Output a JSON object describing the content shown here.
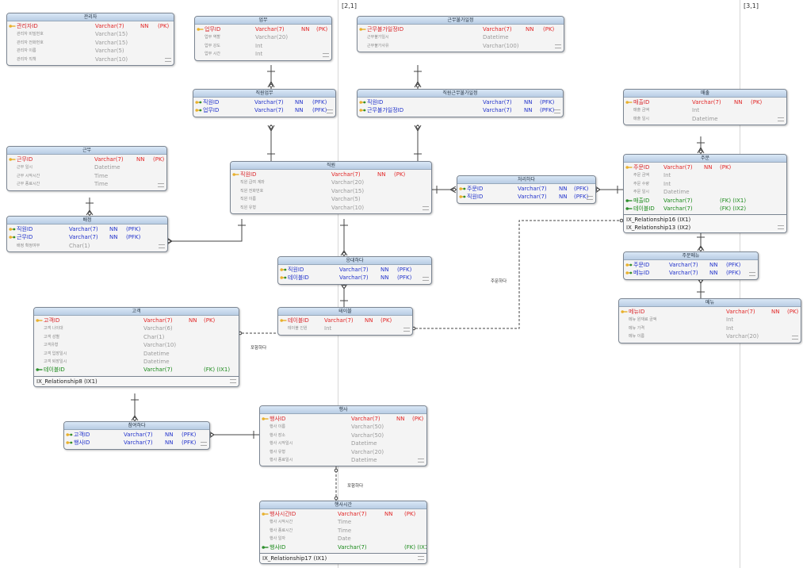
{
  "page_markers": [
    "[2,1]",
    "[3,1]"
  ],
  "entities": [
    {
      "id": "manager",
      "title": "관리자",
      "rows": [
        {
          "kind": "pk",
          "name": "관리자ID",
          "type": "Varchar(7)",
          "nn": "NN",
          "key": "(PK)"
        },
        {
          "kind": "at",
          "name": "관리자 비밀번호",
          "type": "Varchar(15)",
          "nn": "",
          "key": ""
        },
        {
          "kind": "at",
          "name": "관리자 전화번호",
          "type": "Varchar(15)",
          "nn": "",
          "key": ""
        },
        {
          "kind": "at",
          "name": "관리자 이름",
          "type": "Varchar(5)",
          "nn": "",
          "key": ""
        },
        {
          "kind": "at",
          "name": "관리자 직책",
          "type": "Varchar(10)",
          "nn": "",
          "key": ""
        }
      ],
      "indexes": []
    },
    {
      "id": "task",
      "title": "업무",
      "rows": [
        {
          "kind": "pk",
          "name": "업무ID",
          "type": "Varchar(7)",
          "nn": "NN",
          "key": "(PK)"
        },
        {
          "kind": "at",
          "name": "업무 역할",
          "type": "Varchar(20)",
          "nn": "",
          "key": ""
        },
        {
          "kind": "at",
          "name": "업무 강도",
          "type": "Int",
          "nn": "",
          "key": ""
        },
        {
          "kind": "at",
          "name": "업무 시간",
          "type": "Int",
          "nn": "",
          "key": ""
        }
      ],
      "indexes": []
    },
    {
      "id": "unavailable_date",
      "title": "근무불가일정",
      "rows": [
        {
          "kind": "pk",
          "name": "근무불가일정ID",
          "type": "Varchar(7)",
          "nn": "NN",
          "key": "(PK)"
        },
        {
          "kind": "at",
          "name": "근무불가일시",
          "type": "Datetime",
          "nn": "",
          "key": ""
        },
        {
          "kind": "at",
          "name": "근무불가사유",
          "type": "Varchar(100)",
          "nn": "",
          "key": ""
        }
      ],
      "indexes": []
    },
    {
      "id": "staff_task",
      "title": "직원업무",
      "rows": [
        {
          "kind": "pf",
          "name": "직원ID",
          "type": "Varchar(7)",
          "nn": "NN",
          "key": "(PFK)"
        },
        {
          "kind": "pf",
          "name": "업무ID",
          "type": "Varchar(7)",
          "nn": "NN",
          "key": "(PFK)"
        }
      ],
      "indexes": []
    },
    {
      "id": "staff_unavailable",
      "title": "직원근무불가일정",
      "rows": [
        {
          "kind": "pf",
          "name": "직원ID",
          "type": "Varchar(7)",
          "nn": "NN",
          "key": "(PFK)"
        },
        {
          "kind": "pf",
          "name": "근무불가일정ID",
          "type": "Varchar(7)",
          "nn": "NN",
          "key": "(PFK)"
        }
      ],
      "indexes": []
    },
    {
      "id": "sales",
      "title": "매출",
      "rows": [
        {
          "kind": "pk",
          "name": "매출ID",
          "type": "Varchar(7)",
          "nn": "NN",
          "key": "(PK)"
        },
        {
          "kind": "at",
          "name": "매출 금액",
          "type": "Int",
          "nn": "",
          "key": ""
        },
        {
          "kind": "at",
          "name": "매출 일시",
          "type": "Datetime",
          "nn": "",
          "key": ""
        }
      ],
      "indexes": []
    },
    {
      "id": "shift",
      "title": "근무",
      "rows": [
        {
          "kind": "pk",
          "name": "근무ID",
          "type": "Varchar(7)",
          "nn": "NN",
          "key": "(PK)"
        },
        {
          "kind": "at",
          "name": "근무 일시",
          "type": "Datetime",
          "nn": "",
          "key": ""
        },
        {
          "kind": "at",
          "name": "근무 시작시간",
          "type": "Time",
          "nn": "",
          "key": ""
        },
        {
          "kind": "at",
          "name": "근무 종료시간",
          "type": "Time",
          "nn": "",
          "key": ""
        }
      ],
      "indexes": []
    },
    {
      "id": "staff",
      "title": "직원",
      "rows": [
        {
          "kind": "pk",
          "name": "직원ID",
          "type": "Varchar(7)",
          "nn": "NN",
          "key": "(PK)"
        },
        {
          "kind": "at",
          "name": "직원 급여 계좌",
          "type": "Varchar(20)",
          "nn": "",
          "key": ""
        },
        {
          "kind": "at",
          "name": "직원 전화번호",
          "type": "Varchar(15)",
          "nn": "",
          "key": ""
        },
        {
          "kind": "at",
          "name": "직원 이름",
          "type": "Varchar(5)",
          "nn": "",
          "key": ""
        },
        {
          "kind": "at",
          "name": "직원 유형",
          "type": "Varchar(10)",
          "nn": "",
          "key": ""
        }
      ],
      "indexes": []
    },
    {
      "id": "process",
      "title": "처리하다",
      "rows": [
        {
          "kind": "pf",
          "name": "주문ID",
          "type": "Varchar(7)",
          "nn": "NN",
          "key": "(PFK)"
        },
        {
          "kind": "pf",
          "name": "직원ID",
          "type": "Varchar(7)",
          "nn": "NN",
          "key": "(PFK)"
        }
      ],
      "indexes": []
    },
    {
      "id": "order",
      "title": "주문",
      "rows": [
        {
          "kind": "pk",
          "name": "주문ID",
          "type": "Varchar(7)",
          "nn": "NN",
          "key": "(PK)"
        },
        {
          "kind": "at",
          "name": "주문 금액",
          "type": "Int",
          "nn": "",
          "key": ""
        },
        {
          "kind": "at",
          "name": "주문 수량",
          "type": "Int",
          "nn": "",
          "key": ""
        },
        {
          "kind": "at",
          "name": "주문 일시",
          "type": "Datetime",
          "nn": "",
          "key": ""
        },
        {
          "kind": "fk",
          "name": "매출ID",
          "type": "Varchar(7)",
          "nn": "",
          "key": "(FK)  (IX1)"
        },
        {
          "kind": "fk",
          "name": "테이블ID",
          "type": "Varchar(7)",
          "nn": "",
          "key": "(FK)  (IX2)"
        }
      ],
      "indexes": [
        "IX_Relationship16 (IX1)",
        "IX_Relationship13 (IX2)"
      ]
    },
    {
      "id": "assignment",
      "title": "배정",
      "rows": [
        {
          "kind": "pf",
          "name": "직원ID",
          "type": "Varchar(7)",
          "nn": "NN",
          "key": "(PFK)"
        },
        {
          "kind": "pf",
          "name": "근무ID",
          "type": "Varchar(7)",
          "nn": "NN",
          "key": "(PFK)"
        },
        {
          "kind": "at",
          "name": "배정 확정여부",
          "type": "Char(1)",
          "nn": "",
          "key": ""
        }
      ],
      "indexes": []
    },
    {
      "id": "in_charge",
      "title": "응대하다",
      "rows": [
        {
          "kind": "pf",
          "name": "직원ID",
          "type": "Varchar(7)",
          "nn": "NN",
          "key": "(PFK)"
        },
        {
          "kind": "pf",
          "name": "테이블ID",
          "type": "Varchar(7)",
          "nn": "NN",
          "key": "(PFK)"
        }
      ],
      "indexes": []
    },
    {
      "id": "order_menu",
      "title": "주문메뉴",
      "rows": [
        {
          "kind": "pf",
          "name": "주문ID",
          "type": "Varchar(7)",
          "nn": "NN",
          "key": "(PFK)"
        },
        {
          "kind": "pf",
          "name": "메뉴ID",
          "type": "Varchar(7)",
          "nn": "NN",
          "key": "(PFK)"
        }
      ],
      "indexes": []
    },
    {
      "id": "menu",
      "title": "메뉴",
      "rows": [
        {
          "kind": "pk",
          "name": "메뉴ID",
          "type": "Varchar(7)",
          "nn": "NN",
          "key": "(PK)"
        },
        {
          "kind": "at",
          "name": "메뉴 원재료 금액",
          "type": "Int",
          "nn": "",
          "key": ""
        },
        {
          "kind": "at",
          "name": "메뉴 가격",
          "type": "Int",
          "nn": "",
          "key": ""
        },
        {
          "kind": "at",
          "name": "메뉴 이름",
          "type": "Varchar(20)",
          "nn": "",
          "key": ""
        }
      ],
      "indexes": []
    },
    {
      "id": "customer",
      "title": "고객",
      "rows": [
        {
          "kind": "pk",
          "name": "고객ID",
          "type": "Varchar(7)",
          "nn": "NN",
          "key": "(PK)"
        },
        {
          "kind": "at",
          "name": "고객 나이대",
          "type": "Varchar(6)",
          "nn": "",
          "key": ""
        },
        {
          "kind": "at",
          "name": "고객 성별",
          "type": "Char(1)",
          "nn": "",
          "key": ""
        },
        {
          "kind": "at",
          "name": "고객유형",
          "type": "Varchar(10)",
          "nn": "",
          "key": ""
        },
        {
          "kind": "at",
          "name": "고객 입장일시",
          "type": "Datetime",
          "nn": "",
          "key": ""
        },
        {
          "kind": "at",
          "name": "고객 퇴장일시",
          "type": "Datetime",
          "nn": "",
          "key": ""
        },
        {
          "kind": "fk",
          "name": "테이블ID",
          "type": "Varchar(7)",
          "nn": "",
          "key": "(FK)  (IX1)"
        }
      ],
      "indexes": [
        "IX_Relationship8 (IX1)"
      ]
    },
    {
      "id": "table",
      "title": "테이블",
      "rows": [
        {
          "kind": "pk",
          "name": "테이블ID",
          "type": "Varchar(7)",
          "nn": "NN",
          "key": "(PK)"
        },
        {
          "kind": "at",
          "name": "테이블 인원",
          "type": "Int",
          "nn": "",
          "key": ""
        }
      ],
      "indexes": []
    },
    {
      "id": "attend",
      "title": "참여하다",
      "rows": [
        {
          "kind": "pf",
          "name": "고객ID",
          "type": "Varchar(7)",
          "nn": "NN",
          "key": "(PFK)"
        },
        {
          "kind": "pf",
          "name": "행사ID",
          "type": "Varchar(7)",
          "nn": "NN",
          "key": "(PFK)"
        }
      ],
      "indexes": []
    },
    {
      "id": "event",
      "title": "행사",
      "rows": [
        {
          "kind": "pk",
          "name": "행사ID",
          "type": "Varchar(7)",
          "nn": "NN",
          "key": "(PK)"
        },
        {
          "kind": "at",
          "name": "행사 이름",
          "type": "Varchar(50)",
          "nn": "",
          "key": ""
        },
        {
          "kind": "at",
          "name": "행사 장소",
          "type": "Varchar(50)",
          "nn": "",
          "key": ""
        },
        {
          "kind": "at",
          "name": "행사 시작일시",
          "type": "Datetime",
          "nn": "",
          "key": ""
        },
        {
          "kind": "at",
          "name": "행사 유형",
          "type": "Varchar(20)",
          "nn": "",
          "key": ""
        },
        {
          "kind": "at",
          "name": "행사 종료일시",
          "type": "Datetime",
          "nn": "",
          "key": ""
        }
      ],
      "indexes": []
    },
    {
      "id": "event_time",
      "title": "행사시간",
      "rows": [
        {
          "kind": "pk",
          "name": "행사시간ID",
          "type": "Varchar(7)",
          "nn": "NN",
          "key": "(PK)"
        },
        {
          "kind": "at",
          "name": "행사 시작시간",
          "type": "Time",
          "nn": "",
          "key": ""
        },
        {
          "kind": "at",
          "name": "행사 종료시간",
          "type": "Time",
          "nn": "",
          "key": ""
        },
        {
          "kind": "at",
          "name": "행사 일자",
          "type": "Date",
          "nn": "",
          "key": ""
        },
        {
          "kind": "fk",
          "name": "행사ID",
          "type": "Varchar(7)",
          "nn": "",
          "key": "(FK)  (IX1)"
        }
      ],
      "indexes": [
        "IX_Relationship17 (IX1)"
      ]
    }
  ],
  "relationship_labels": [
    "주문하다",
    "포함하다",
    "포함하다"
  ],
  "colors": {
    "pk": "#e22626",
    "pfk": "#2233cc",
    "fk": "#1b8a1b",
    "attribute": "#9a9a9a",
    "header": "#c8d9ec",
    "border": "#7b8592"
  }
}
